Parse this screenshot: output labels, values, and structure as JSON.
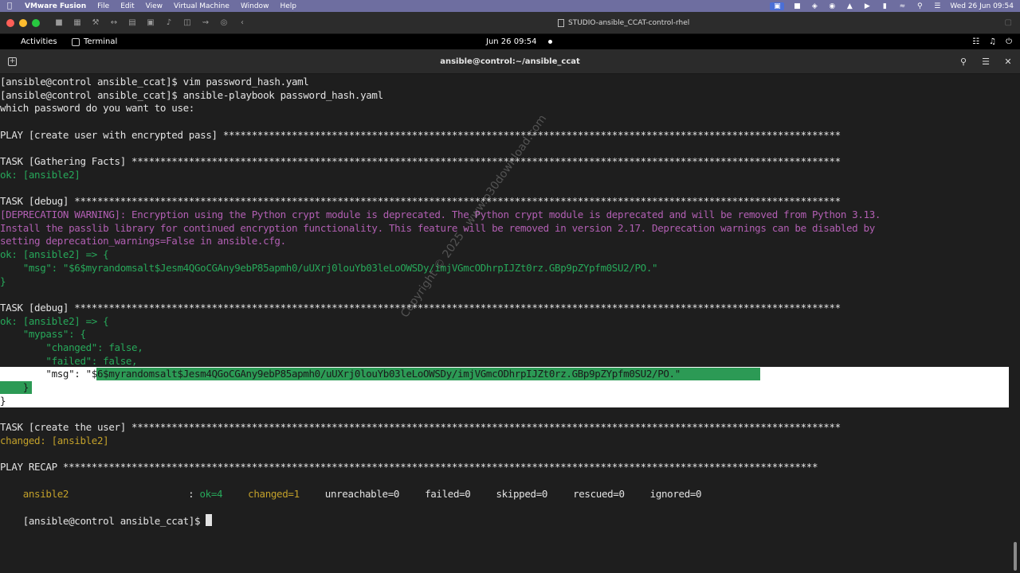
{
  "mac_menu": {
    "app": "VMware Fusion",
    "items": [
      "File",
      "Edit",
      "View",
      "Virtual Machine",
      "Window",
      "Help"
    ],
    "clock": "Wed 26 Jun  09:54"
  },
  "vm_window": {
    "title": "STUDIO-ansible_CCAT-control-rhel"
  },
  "gnome": {
    "activities": "Activities",
    "app": "Terminal",
    "date": "Jun 26  09:54"
  },
  "terminal": {
    "title": "ansible@control:~/ansible_ccat",
    "lines": [
      {
        "t": "[ansible@control ansible_ccat]$ vim password_hash.yaml",
        "c": "white"
      },
      {
        "t": "[ansible@control ansible_ccat]$ ansible-playbook password_hash.yaml",
        "c": "white"
      },
      {
        "t": "which password do you want to use:",
        "c": "white"
      },
      {
        "t": "",
        "c": "white"
      },
      {
        "t": "PLAY [create user with encrypted pass] ************************************************************************************************************",
        "c": "white"
      },
      {
        "t": "",
        "c": "white"
      },
      {
        "t": "TASK [Gathering Facts] ****************************************************************************************************************************",
        "c": "white"
      },
      {
        "t": "ok: [ansible2]",
        "c": "green"
      },
      {
        "t": "",
        "c": "white"
      },
      {
        "t": "TASK [debug] **************************************************************************************************************************************",
        "c": "white"
      },
      {
        "t": "[DEPRECATION WARNING]: Encryption using the Python crypt module is deprecated. The Python crypt module is deprecated and will be removed from Python 3.13.",
        "c": "purple"
      },
      {
        "t": "Install the passlib library for continued encryption functionality. This feature will be removed in version 2.17. Deprecation warnings can be disabled by",
        "c": "purple"
      },
      {
        "t": "setting deprecation_warnings=False in ansible.cfg.",
        "c": "purple"
      },
      {
        "t": "ok: [ansible2] => {",
        "c": "green"
      },
      {
        "t": "    \"msg\": \"$6$myrandomsalt$Jesm4QGoCGAny9ebP85apmh0/uUXrj0louYb03leLoOWSDy/imjVGmcODhrpIJZt0rz.GBp9pZYpfm0SU2/PO.\"",
        "c": "green"
      },
      {
        "t": "}",
        "c": "green"
      },
      {
        "t": "",
        "c": "white"
      },
      {
        "t": "TASK [debug] **************************************************************************************************************************************",
        "c": "white"
      },
      {
        "t": "ok: [ansible2] => {",
        "c": "green"
      },
      {
        "t": "    \"mypass\": {",
        "c": "green"
      },
      {
        "t": "        \"changed\": false,",
        "c": "green"
      },
      {
        "t": "        \"failed\": false,",
        "c": "green"
      },
      {
        "t": "        \"msg\": \"$6$myrandomsalt$Jesm4QGoCGAny9ebP85apmh0/uUXrj0louYb03leLoOWSDy/imjVGmcODhrpIJZt0rz.GBp9pZYpfm0SU2/PO.\"",
        "c": "green"
      },
      {
        "t": "    }",
        "c": "green"
      },
      {
        "t": "}",
        "c": "green"
      },
      {
        "t": "",
        "c": "white"
      },
      {
        "t": "TASK [create the user] ****************************************************************************************************************************",
        "c": "white"
      },
      {
        "t": "changed: [ansible2]",
        "c": "yellow"
      },
      {
        "t": "",
        "c": "white"
      },
      {
        "t": "PLAY RECAP ************************************************************************************************************************************",
        "c": "white"
      }
    ],
    "recap": {
      "host": "ansible2",
      "sep": ": ",
      "ok": "ok=4",
      "changed": "changed=1",
      "unreachable": "unreachable=0",
      "failed": "failed=0",
      "skipped": "skipped=0",
      "rescued": "rescued=0",
      "ignored": "ignored=0"
    },
    "prompt": "[ansible@control ansible_ccat]$ "
  },
  "watermark": "Copyright © 2025 - www.p30download.com",
  "colors": {
    "green": "#27a85a",
    "yellow": "#c2a02a",
    "purple": "#b25fb3",
    "white": "#e3e3e3"
  }
}
